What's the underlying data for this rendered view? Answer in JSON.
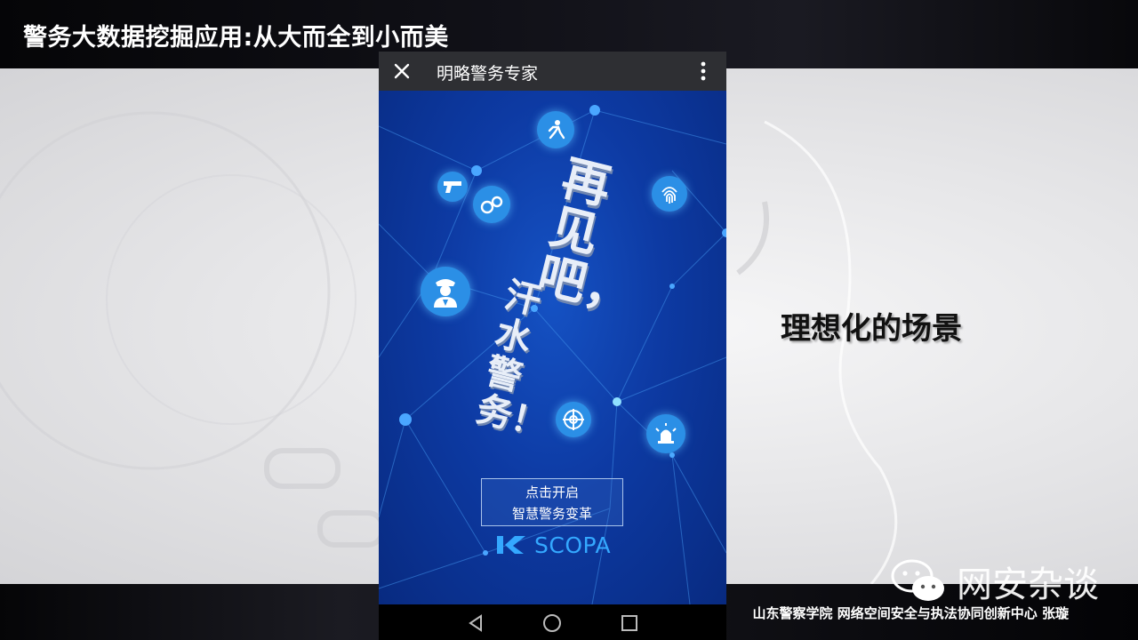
{
  "slide": {
    "title": "警务大数据挖掘应用:从大而全到小而美",
    "caption": "理想化的场景",
    "footer": "山东警察学院 网络空间安全与执法协同创新中心 张璇",
    "watermark": "网安杂谈"
  },
  "phone": {
    "title": "明略警务专家",
    "poster": {
      "headline": "再见吧，",
      "subline": "汗水警务！",
      "cta_line1": "点击开启",
      "cta_line2": "智慧警务变革",
      "brand": "SCOPA"
    }
  },
  "icons": [
    "close-icon",
    "more-vertical-icon",
    "running-suspect-icon",
    "pistol-icon",
    "handcuffs-icon",
    "fingerprint-icon",
    "police-officer-icon",
    "target-crosshair-icon",
    "siren-icon",
    "scopa-logo-icon",
    "back-triangle-icon",
    "home-circle-icon",
    "recents-square-icon"
  ],
  "colors": {
    "app_bar": "#2e2f33",
    "poster_blue": "#0d3aa3",
    "icon_blue": "#2b8fe6",
    "brand_blue": "#34a8ff"
  }
}
